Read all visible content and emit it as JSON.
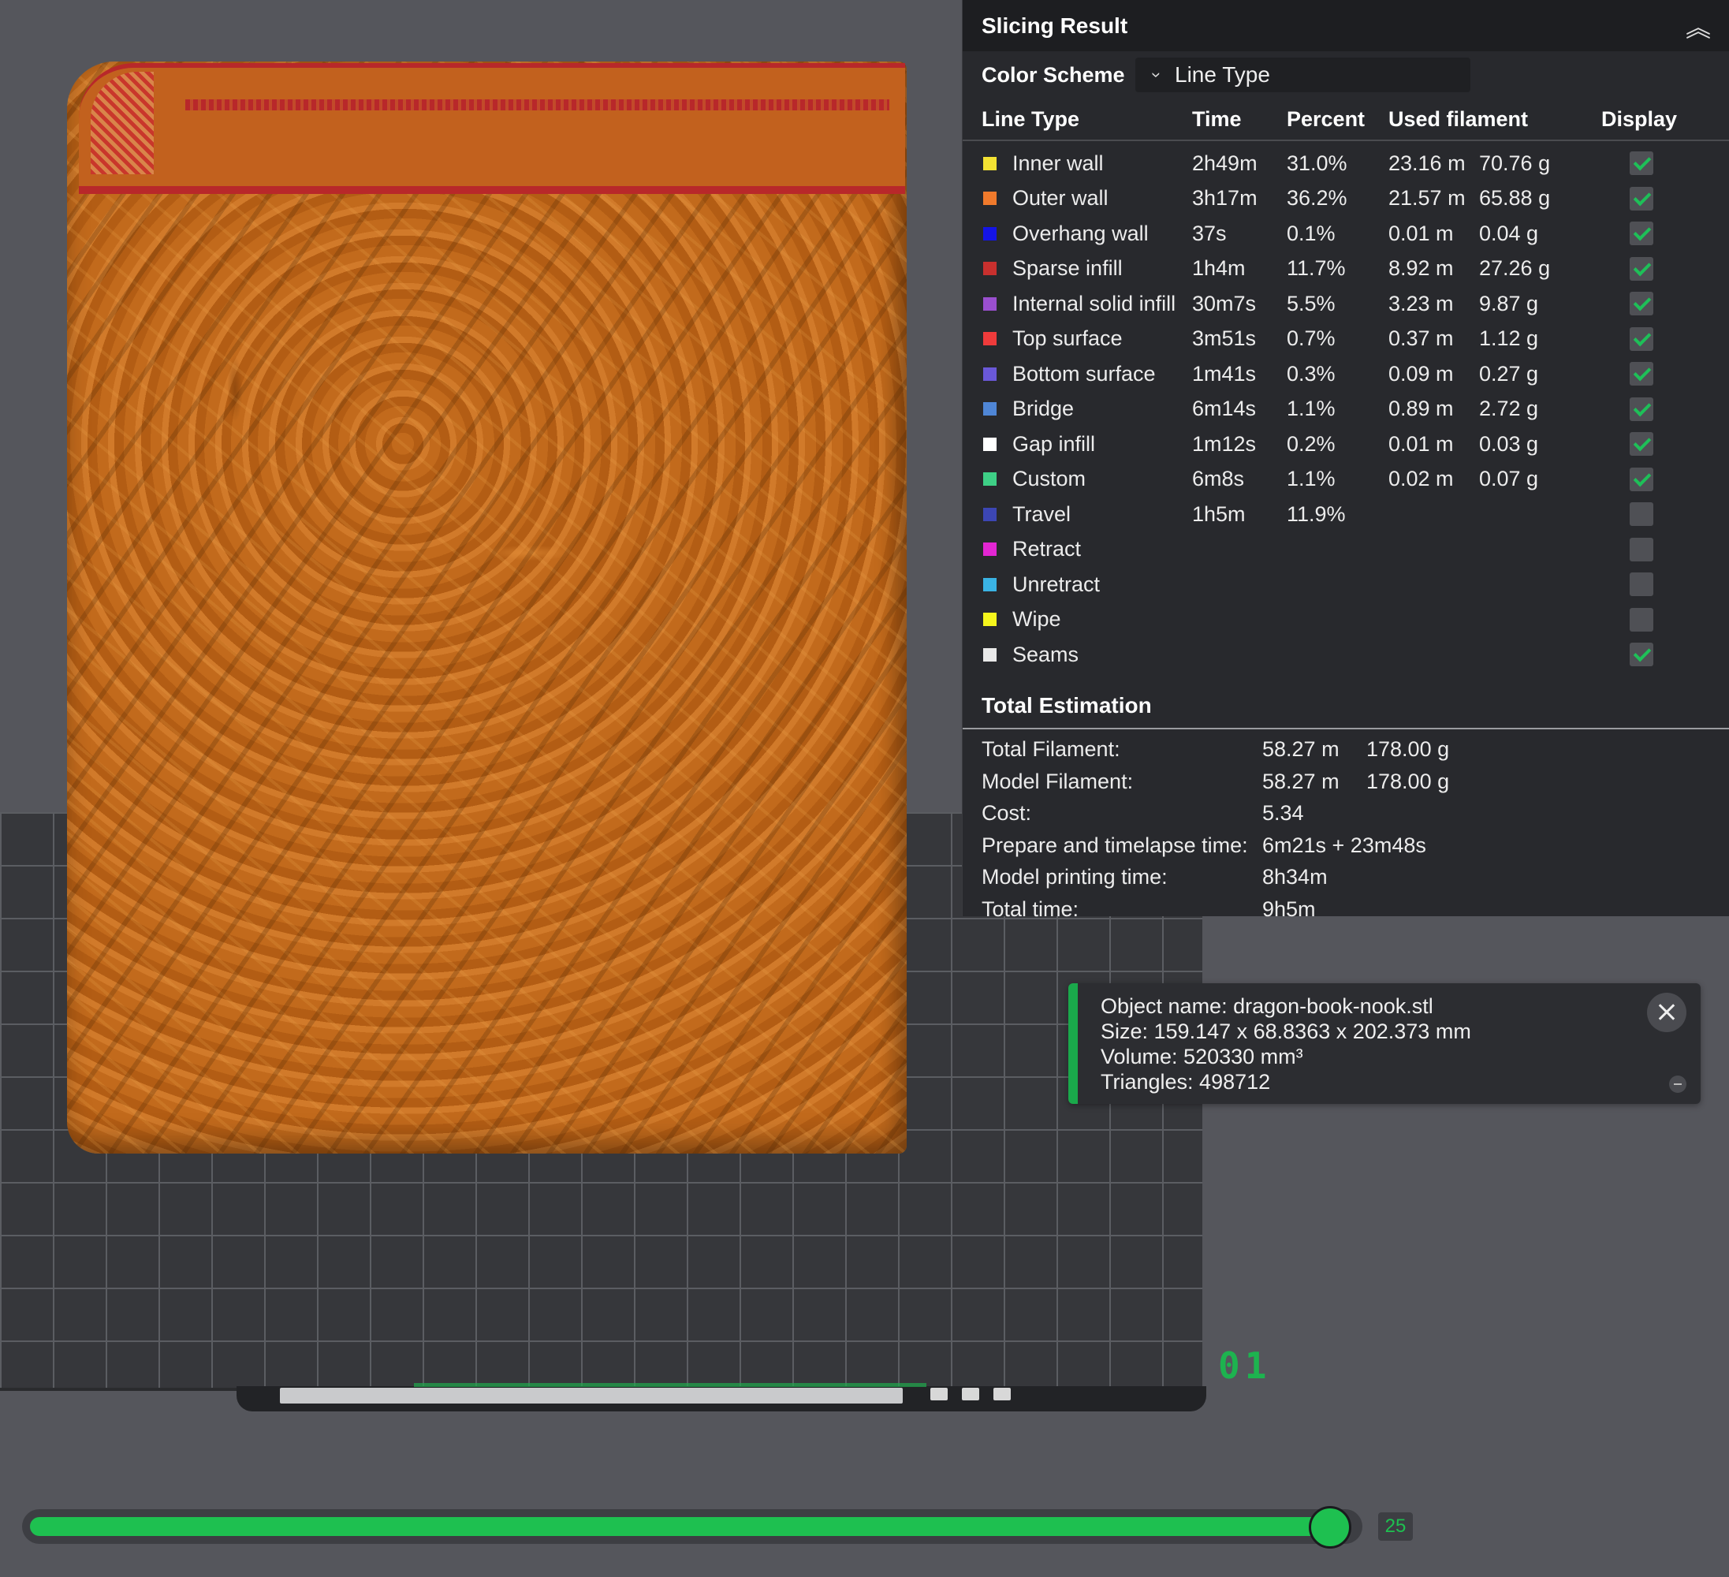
{
  "panel": {
    "title": "Slicing Result",
    "color_scheme_label": "Color Scheme",
    "color_scheme_value": "Line Type",
    "columns": {
      "line_type": "Line Type",
      "time": "Time",
      "percent": "Percent",
      "used_filament": "Used filament",
      "display": "Display"
    },
    "rows": [
      {
        "name": "Inner wall",
        "time": "2h49m",
        "percent": "31.0%",
        "meters": "23.16 m",
        "grams": "70.76 g",
        "color": "#f4e233",
        "display": true
      },
      {
        "name": "Outer wall",
        "time": "3h17m",
        "percent": "36.2%",
        "meters": "21.57 m",
        "grams": "65.88 g",
        "color": "#f07a2c",
        "display": true
      },
      {
        "name": "Overhang wall",
        "time": "37s",
        "percent": "0.1%",
        "meters": "0.01 m",
        "grams": "0.04 g",
        "color": "#1414e6",
        "display": true
      },
      {
        "name": "Sparse infill",
        "time": "1h4m",
        "percent": "11.7%",
        "meters": "8.92 m",
        "grams": "27.26 g",
        "color": "#c8302e",
        "display": true
      },
      {
        "name": "Internal solid infill",
        "time": "30m7s",
        "percent": "5.5%",
        "meters": "3.23 m",
        "grams": "9.87 g",
        "color": "#9a4fcf",
        "display": true
      },
      {
        "name": "Top surface",
        "time": "3m51s",
        "percent": "0.7%",
        "meters": "0.37 m",
        "grams": "1.12 g",
        "color": "#ef3b3b",
        "display": true
      },
      {
        "name": "Bottom surface",
        "time": "1m41s",
        "percent": "0.3%",
        "meters": "0.09 m",
        "grams": "0.27 g",
        "color": "#6a58d8",
        "display": true
      },
      {
        "name": "Bridge",
        "time": "6m14s",
        "percent": "1.1%",
        "meters": "0.89 m",
        "grams": "2.72 g",
        "color": "#4f86d6",
        "display": true
      },
      {
        "name": "Gap infill",
        "time": "1m12s",
        "percent": "0.2%",
        "meters": "0.01 m",
        "grams": "0.03 g",
        "color": "#ffffff",
        "display": true
      },
      {
        "name": "Custom",
        "time": "6m8s",
        "percent": "1.1%",
        "meters": "0.02 m",
        "grams": "0.07 g",
        "color": "#3ecf86",
        "display": true
      },
      {
        "name": "Travel",
        "time": "1h5m",
        "percent": "11.9%",
        "meters": "",
        "grams": "",
        "color": "#3c46b4",
        "display": false
      },
      {
        "name": "Retract",
        "time": "",
        "percent": "",
        "meters": "",
        "grams": "",
        "color": "#e326d3",
        "display": false
      },
      {
        "name": "Unretract",
        "time": "",
        "percent": "",
        "meters": "",
        "grams": "",
        "color": "#3ab3e4",
        "display": false
      },
      {
        "name": "Wipe",
        "time": "",
        "percent": "",
        "meters": "",
        "grams": "",
        "color": "#f5f51c",
        "display": false
      },
      {
        "name": "Seams",
        "time": "",
        "percent": "",
        "meters": "",
        "grams": "",
        "color": "#e9e9e9",
        "display": true
      }
    ],
    "total_title": "Total Estimation",
    "totals": [
      {
        "label": "Total Filament:",
        "v1": "58.27 m",
        "v2": "178.00 g"
      },
      {
        "label": "Model Filament:",
        "v1": "58.27 m",
        "v2": "178.00 g"
      },
      {
        "label": "Cost:",
        "v1": "5.34",
        "v2": ""
      },
      {
        "label": "Prepare and timelapse time:",
        "v1": "6m21s + 23m48s",
        "v2": ""
      },
      {
        "label": "Model printing time:",
        "v1": "8h34m",
        "v2": ""
      },
      {
        "label": "Total time:",
        "v1": "9h5m",
        "v2": ""
      }
    ]
  },
  "object_info": {
    "name": "Object name: dragon-book-nook.stl",
    "size": "Size: 159.147 x 68.8363 x 202.373 mm",
    "volume": "Volume: 520330 mm³",
    "triangles": "Triangles: 498712"
  },
  "plate_number": "01",
  "layer_slider": {
    "value": "25",
    "fraction": 0.98
  },
  "colors": {
    "accent": "#1ec050",
    "panel_bg": "#28292d",
    "model": "#c8691c"
  },
  "icons": {
    "collapse": "double-chevron-up-icon",
    "dropdown": "chevron-down-icon",
    "close": "close-icon"
  }
}
